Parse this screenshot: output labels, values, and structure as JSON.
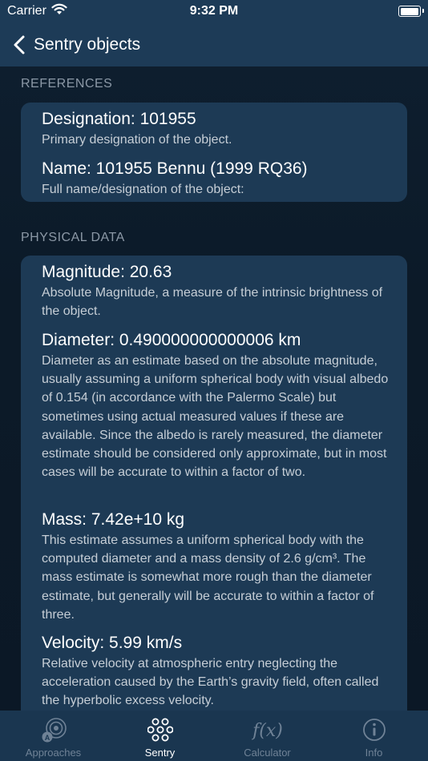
{
  "status_bar": {
    "carrier": "Carrier",
    "time": "9:32 PM"
  },
  "nav": {
    "back_label": "Sentry objects"
  },
  "sections": {
    "references": {
      "header": "REFERENCES",
      "rows": [
        {
          "title": "Designation: 101955",
          "desc": "Primary designation of the object."
        },
        {
          "title": "Name: 101955 Bennu (1999 RQ36)",
          "desc": "Full name/designation of the object:"
        }
      ]
    },
    "physical": {
      "header": "PHYSICAL DATA",
      "rows": [
        {
          "title": "Magnitude: 20.63",
          "desc": "Absolute Magnitude, a measure of the intrinsic brightness of the object."
        },
        {
          "title": "Diameter: 0.490000000000006 km",
          "desc": "Diameter as an estimate based on the absolute magnitude, usually assuming a uniform spherical body with visual albedo of 0.154 (in accordance with the Palermo Scale) but sometimes using actual measured values if these are available. Since the albedo is rarely measured, the diameter estimate should be considered only approximate, but in most cases will be accurate to within a factor of two."
        },
        {
          "title": "Mass: 7.42e+10 kg",
          "desc": "This estimate assumes a uniform spherical body with the computed diameter and a mass density of 2.6 g/cm³. The mass estimate is somewhat more rough than the diameter estimate, but generally will be accurate to within a factor of three."
        },
        {
          "title": "Velocity: 5.99 km/s",
          "desc": "Relative velocity at atmospheric entry neglecting the acceleration caused by the Earth’s gravity field, often called the hyperbolic excess velocity."
        }
      ]
    }
  },
  "tabs": [
    {
      "label": "Approaches",
      "icon": "approaches-icon"
    },
    {
      "label": "Sentry",
      "icon": "sentry-icon",
      "active": true
    },
    {
      "label": "Calculator",
      "icon": "function-icon"
    },
    {
      "label": "Info",
      "icon": "info-icon"
    }
  ],
  "colors": {
    "bar": "#1d3b57",
    "card": "#1d3a55",
    "background": "#0c1a28",
    "inactive_tab": "#6f8296"
  }
}
